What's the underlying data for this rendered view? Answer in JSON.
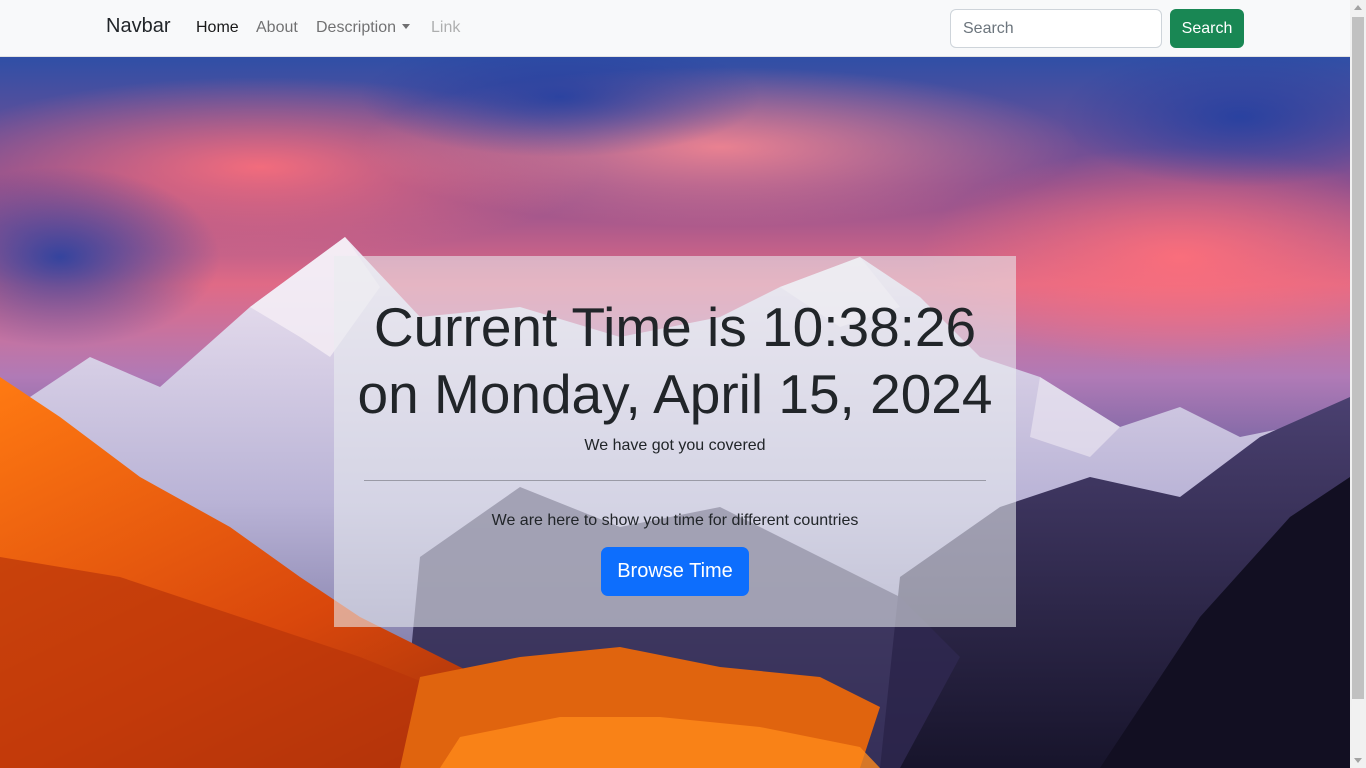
{
  "navbar": {
    "brand": "Navbar",
    "links": [
      {
        "label": "Home",
        "state": "active"
      },
      {
        "label": "About",
        "state": "normal"
      },
      {
        "label": "Description",
        "state": "dropdown"
      },
      {
        "label": "Link",
        "state": "disabled"
      }
    ],
    "search": {
      "placeholder": "Search",
      "value": "",
      "button_label": "Search"
    }
  },
  "hero": {
    "background": "mountain-landscape-image",
    "time_line1": "Current Time is 10:38:26",
    "time_line2": "on Monday, April 15, 2024",
    "lead": "We have got you covered",
    "description": "We are here to show you time for different countries",
    "button_label": "Browse Time"
  },
  "colors": {
    "navbar_bg": "#f8f9fa",
    "search_button": "#198754",
    "primary_button": "#0d6efd",
    "text": "#212529"
  }
}
